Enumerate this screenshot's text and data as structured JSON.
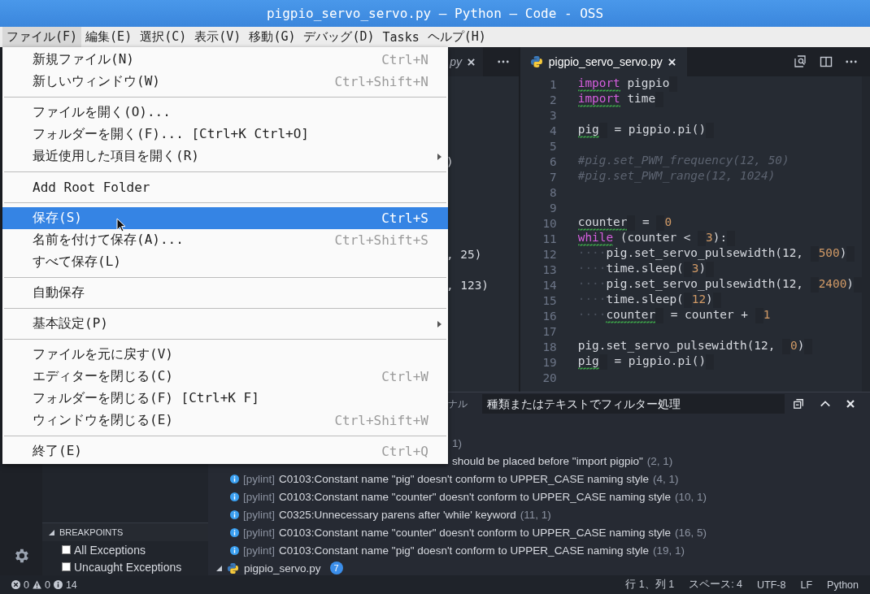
{
  "window": {
    "title": "pigpio_servo_servo.py — Python — Code - OSS"
  },
  "menubar": [
    {
      "label": "ファイル(F)",
      "selected": true
    },
    {
      "label": "編集(E)",
      "selected": false
    },
    {
      "label": "選択(C)",
      "selected": false
    },
    {
      "label": "表示(V)",
      "selected": false
    },
    {
      "label": "移動(G)",
      "selected": false
    },
    {
      "label": "デバッグ(D)",
      "selected": false
    },
    {
      "label": "Tasks",
      "selected": false
    },
    {
      "label": "ヘルプ(H)",
      "selected": false
    }
  ],
  "file_menu": [
    {
      "kind": "item",
      "label": "新規ファイル(N)",
      "shortcut": "Ctrl+N",
      "submenu": false,
      "selected": false
    },
    {
      "kind": "item",
      "label": "新しいウィンドウ(W)",
      "shortcut": "Ctrl+Shift+N",
      "submenu": false,
      "selected": false
    },
    {
      "kind": "separator"
    },
    {
      "kind": "item",
      "label": "ファイルを開く(O)...",
      "submenu": false,
      "selected": false
    },
    {
      "kind": "item",
      "label": "フォルダーを開く(F)... [Ctrl+K Ctrl+O]",
      "submenu": false,
      "selected": false
    },
    {
      "kind": "item",
      "label": "最近使用した項目を開く(R)",
      "submenu": true,
      "selected": false
    },
    {
      "kind": "separator"
    },
    {
      "kind": "item",
      "label": "Add Root Folder",
      "submenu": false,
      "selected": false
    },
    {
      "kind": "separator"
    },
    {
      "kind": "item",
      "label": "保存(S)",
      "shortcut": "Ctrl+S",
      "submenu": false,
      "selected": true
    },
    {
      "kind": "item",
      "label": "名前を付けて保存(A)...",
      "shortcut": "Ctrl+Shift+S",
      "submenu": false,
      "selected": false
    },
    {
      "kind": "item",
      "label": "すべて保存(L)",
      "submenu": false,
      "selected": false
    },
    {
      "kind": "separator"
    },
    {
      "kind": "item",
      "label": "自動保存",
      "submenu": false,
      "selected": false
    },
    {
      "kind": "separator"
    },
    {
      "kind": "item",
      "label": "基本設定(P)",
      "submenu": true,
      "selected": false
    },
    {
      "kind": "separator"
    },
    {
      "kind": "item",
      "label": "ファイルを元に戻す(V)",
      "submenu": false,
      "selected": false
    },
    {
      "kind": "item",
      "label": "エディターを閉じる(C)",
      "shortcut": "Ctrl+W",
      "submenu": false,
      "selected": false
    },
    {
      "kind": "item",
      "label": "フォルダーを閉じる(F) [Ctrl+K F]",
      "submenu": false,
      "selected": false
    },
    {
      "kind": "item",
      "label": "ウィンドウを閉じる(E)",
      "shortcut": "Ctrl+Shift+W",
      "submenu": false,
      "selected": false
    },
    {
      "kind": "separator"
    },
    {
      "kind": "item",
      "label": "終了(E)",
      "shortcut": "Ctrl+Q",
      "submenu": false,
      "selected": false
    }
  ],
  "sidebar": {
    "breakpoints": {
      "title": "BREAKPOINTS",
      "items": [
        {
          "label": "All Exceptions",
          "checked": false
        },
        {
          "label": "Uncaught Exceptions",
          "checked": false
        }
      ]
    }
  },
  "left_editor": {
    "tab": {
      "label": "py",
      "selected": false
    },
    "code_fragments": [
      ")",
      ", 25)",
      ", 123)"
    ]
  },
  "right_editor": {
    "tab": {
      "label": "pigpio_servo_servo.py",
      "selected": true
    },
    "lines": [
      {
        "number": "1",
        "tokens": [
          {
            "text": "import",
            "kind": "kw",
            "warning": true
          },
          {
            "text": " pigpio",
            "kind": "code",
            "warning": false
          }
        ]
      },
      {
        "number": "2",
        "tokens": [
          {
            "text": "import",
            "kind": "kw",
            "warning": true
          },
          {
            "text": " time",
            "kind": "code",
            "warning": false
          }
        ]
      },
      {
        "number": "3"
      },
      {
        "number": "4",
        "tokens": [
          {
            "text": "pig",
            "kind": "code",
            "warning": true
          },
          {
            "text": " = pigpio.pi()",
            "kind": "code",
            "warning": false
          }
        ]
      },
      {
        "number": "5"
      },
      {
        "number": "6",
        "tokens": [
          {
            "text": "#pig.set_PWM_frequency(12, 50)",
            "kind": "cmt",
            "warning": false
          }
        ]
      },
      {
        "number": "7",
        "tokens": [
          {
            "text": "#pig.set_PWM_range(12, 1024)",
            "kind": "cmt",
            "warning": false
          }
        ]
      },
      {
        "number": "8"
      },
      {
        "number": "9"
      },
      {
        "number": "10",
        "tokens": [
          {
            "text": "counter",
            "kind": "code",
            "warning": true
          },
          {
            "text": " = ",
            "kind": "code",
            "warning": false
          },
          {
            "text": "0",
            "kind": "num",
            "warning": false
          }
        ]
      },
      {
        "number": "11",
        "tokens": [
          {
            "text": "while",
            "kind": "kw",
            "warning": true
          },
          {
            "text": " (counter < ",
            "kind": "code",
            "warning": false
          },
          {
            "text": "3",
            "kind": "num",
            "warning": false
          },
          {
            "text": "):",
            "kind": "code",
            "warning": false
          }
        ]
      },
      {
        "number": "12",
        "tokens": [
          {
            "text": "····",
            "kind": "indent",
            "warning": false
          },
          {
            "text": "pig.set_servo_pulsewidth(12, ",
            "kind": "code",
            "warning": false
          },
          {
            "text": "500",
            "kind": "num",
            "warning": false
          },
          {
            "text": ")",
            "kind": "code",
            "warning": false
          }
        ]
      },
      {
        "number": "13",
        "tokens": [
          {
            "text": "····",
            "kind": "indent",
            "warning": false
          },
          {
            "text": "time.sleep(",
            "kind": "code",
            "warning": false
          },
          {
            "text": "3",
            "kind": "num",
            "warning": false
          },
          {
            "text": ")",
            "kind": "code",
            "warning": false
          }
        ]
      },
      {
        "number": "14",
        "tokens": [
          {
            "text": "····",
            "kind": "indent",
            "warning": false
          },
          {
            "text": "pig.set_servo_pulsewidth(12, ",
            "kind": "code",
            "warning": false
          },
          {
            "text": "2400",
            "kind": "num",
            "warning": false
          },
          {
            "text": ")",
            "kind": "code",
            "warning": false
          }
        ]
      },
      {
        "number": "15",
        "tokens": [
          {
            "text": "····",
            "kind": "indent",
            "warning": false
          },
          {
            "text": "time.sleep(",
            "kind": "code",
            "warning": false
          },
          {
            "text": "12",
            "kind": "num",
            "warning": false
          },
          {
            "text": ")",
            "kind": "code",
            "warning": false
          }
        ]
      },
      {
        "number": "16",
        "tokens": [
          {
            "text": "····",
            "kind": "indent",
            "warning": false
          },
          {
            "text": "counter",
            "kind": "code",
            "warning": true
          },
          {
            "text": " = counter + ",
            "kind": "code",
            "warning": false
          },
          {
            "text": "1",
            "kind": "num",
            "warning": false
          }
        ]
      },
      {
        "number": "17"
      },
      {
        "number": "18",
        "tokens": [
          {
            "text": "pig.set_servo_pulsewidth(12, ",
            "kind": "code",
            "warning": false
          },
          {
            "text": "0",
            "kind": "num",
            "warning": false
          },
          {
            "text": ")",
            "kind": "code",
            "warning": false
          }
        ]
      },
      {
        "number": "19",
        "tokens": [
          {
            "text": "pig",
            "kind": "code",
            "warning": true
          },
          {
            "text": " = pigpio.pi()",
            "kind": "code",
            "warning": false
          }
        ]
      },
      {
        "number": "20"
      }
    ]
  },
  "panel": {
    "tab_fragment": "ナル",
    "filter": {
      "placeholder": "種類またはテキストでフィルター処理"
    },
    "problems": [
      {
        "kind": "partial",
        "location": "1)"
      },
      {
        "kind": "partial",
        "message": "should be placed before \"import pigpio\"",
        "location": "(2, 1)"
      },
      {
        "kind": "full",
        "source": "[pylint]",
        "message": "C0103:Constant name \"pig\" doesn't conform to UPPER_CASE naming style",
        "location": "(4, 1)"
      },
      {
        "kind": "full",
        "source": "[pylint]",
        "message": "C0103:Constant name \"counter\" doesn't conform to UPPER_CASE naming style",
        "location": "(10, 1)"
      },
      {
        "kind": "full",
        "source": "[pylint]",
        "message": "C0325:Unnecessary parens after 'while' keyword",
        "location": "(11, 1)"
      },
      {
        "kind": "full",
        "source": "[pylint]",
        "message": "C0103:Constant name \"counter\" doesn't conform to UPPER_CASE naming style",
        "location": "(16, 5)"
      },
      {
        "kind": "full",
        "source": "[pylint]",
        "message": "C0103:Constant name \"pig\" doesn't conform to UPPER_CASE naming style",
        "location": "(19, 1)"
      }
    ],
    "file_group": {
      "name": "pigpio_servo.py",
      "count": "7"
    }
  },
  "status_bar": {
    "errors": "0",
    "warnings": "0",
    "infos": "14",
    "right": [
      "行 1、列 1",
      "スペース: 4",
      "UTF-8",
      "LF",
      "Python"
    ]
  }
}
